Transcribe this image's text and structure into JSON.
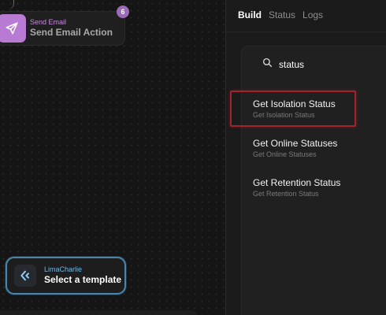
{
  "canvas": {
    "send_node": {
      "kind": "Send Email",
      "name": "Send Email Action",
      "badge": "6"
    },
    "lima_node": {
      "kind": "LimaCharlie",
      "name": "Select a template"
    }
  },
  "panel": {
    "tabs": [
      {
        "label": "Build",
        "active": true
      },
      {
        "label": "Status",
        "active": false
      },
      {
        "label": "Logs",
        "active": false
      }
    ],
    "search": {
      "value": "status",
      "placeholder": ""
    },
    "results": [
      {
        "title": "Get Isolation Status",
        "subtitle": "Get Isolation Status",
        "highlighted": true
      },
      {
        "title": "Get Online Statuses",
        "subtitle": "Get Online Statuses",
        "highlighted": false
      },
      {
        "title": "Get Retention Status",
        "subtitle": "Get Retention Status",
        "highlighted": false
      }
    ]
  },
  "colors": {
    "send_accent": "#b87ad3",
    "lima_accent": "#4a84a8",
    "highlight": "#a0242d"
  }
}
